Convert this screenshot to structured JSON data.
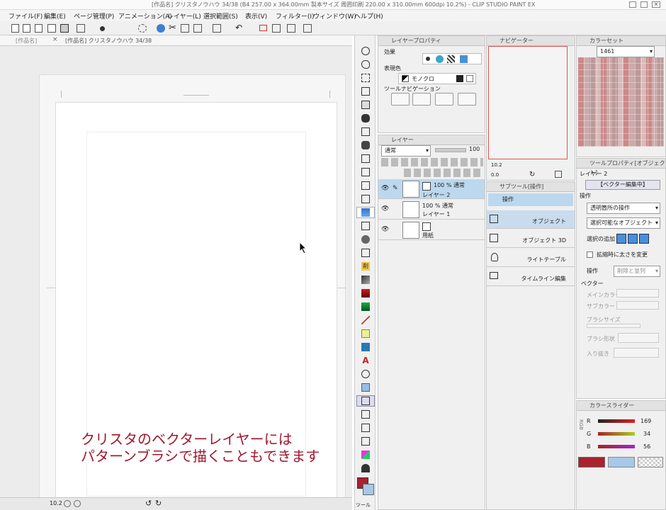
{
  "window_title": "[作品名] クリスタノウハウ 34/38 (B4 257.00 x 364.00mm 製本サイズ 周囲印刷 220.00 x 310.00mm 600dpi 10.2%) - CLIP STUDIO PAINT EX",
  "menu": [
    "ファイル(F)",
    "編集(E)",
    "ページ管理(P)",
    "アニメーション(A)",
    "レイヤー(L)",
    "選択範囲(S)",
    "表示(V)",
    "フィルター(I)",
    "ウィンドウ(W)",
    "ヘルプ(H)"
  ],
  "tabs": [
    "[作品名]",
    "[作品名] クリスタノウハウ 34/38"
  ],
  "canvas": {
    "zoom": "10.2",
    "caption_line1": "クリスタのベクターレイヤーには",
    "caption_line2": "パターンブラシで描くこともできます",
    "caption_color": "#a0182e"
  },
  "layer_property": {
    "title": "レイヤープロパティ",
    "effect_label": "効果",
    "expression_label": "表現色",
    "expression_value": "モノクロ",
    "tool_nav_label": "ツールナビゲーション"
  },
  "navigator": {
    "title": "ナビゲーター",
    "zoom": "10.2",
    "angle": "0.0"
  },
  "color_set": {
    "title": "カラーセット",
    "set_name": "1461"
  },
  "layers": {
    "title": "レイヤー",
    "blend": "通常",
    "opacity": "100",
    "items": [
      {
        "opacity_mode": "100 % 通常",
        "name": "レイヤー 2"
      },
      {
        "opacity_mode": "100 % 通常",
        "name": "レイヤー 1"
      },
      {
        "opacity_mode": "",
        "name": "用紙"
      }
    ]
  },
  "sub_tool": {
    "title": "サブツール[操作]",
    "group": "操作",
    "items": [
      "オブジェクト",
      "オブジェクト 3D",
      "ライトテーブル",
      "タイムライン編集"
    ]
  },
  "tool_property": {
    "title": "ツールプロパティ[オブジェクト]",
    "layer_name": "レイヤー 2",
    "mode_button": "【ベクター編集中】",
    "section_operation": "操作",
    "transparent_op": "透明箇所の操作",
    "selectable": "選択可能なオブジェクト",
    "add_selection": "選択の追加",
    "scale_label": "拡縮時に太さを変更",
    "operation_label": "操作",
    "operation_value": "削除と並列",
    "section_vector": "ベクター",
    "main_color": "メインカラー",
    "sub_color": "サブカラー",
    "brush_size": "ブラシサイズ",
    "brush_shape": "ブラシ形状",
    "start_end": "入り抜き"
  },
  "color_slider": {
    "title": "カラースライダー",
    "mode": "RGB",
    "r": "169",
    "g": "34",
    "b": "56",
    "r_label": "R",
    "g_label": "G",
    "b_label": "B",
    "main_color": "#a9222e",
    "sub_color": "#a8c8e8"
  },
  "bottom": {
    "tool_tab": "ツール"
  }
}
